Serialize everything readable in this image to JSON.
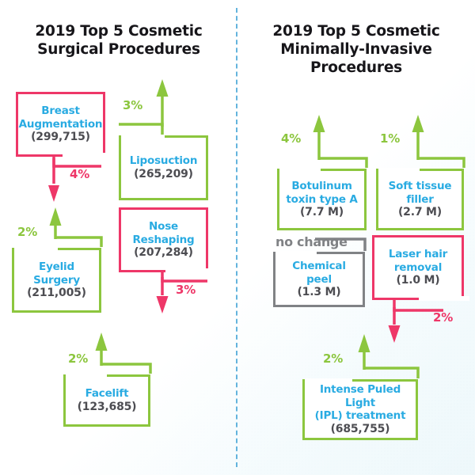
{
  "colors": {
    "green": "#8cc63e",
    "pink": "#ee3768",
    "gray": "#808285",
    "label_blue": "#29abe2",
    "value_gray": "#4d4d52",
    "title_black": "#17161a",
    "divider_blue": "#4aa8d8"
  },
  "panels": {
    "left": {
      "title_line1": "2019 Top 5 Cosmetic",
      "title_line2": "Surgical Procedures",
      "title_line3": "",
      "items": [
        {
          "name_line1": "Breast",
          "name_line2": "Augmentation",
          "value": "(299,715)",
          "change": "4%",
          "direction": "down",
          "color": "pink"
        },
        {
          "name_line1": "Liposuction",
          "name_line2": "",
          "value": "(265,209)",
          "change": "3%",
          "direction": "up",
          "color": "green"
        },
        {
          "name_line1": "Eyelid",
          "name_line2": "Surgery",
          "value": "(211,005)",
          "change": "2%",
          "direction": "up",
          "color": "green"
        },
        {
          "name_line1": "Nose",
          "name_line2": "Reshaping",
          "value": "(207,284)",
          "change": "3%",
          "direction": "down",
          "color": "pink"
        },
        {
          "name_line1": "Facelift",
          "name_line2": "",
          "value": "(123,685)",
          "change": "2%",
          "direction": "up",
          "color": "green"
        }
      ]
    },
    "right": {
      "title_line1": "2019 Top 5 Cosmetic",
      "title_line2": "Minimally-Invasive",
      "title_line3": "Procedures",
      "items": [
        {
          "name_line1": "Botulinum",
          "name_line2": "toxin type A",
          "value": "(7.7 M)",
          "change": "4%",
          "direction": "up",
          "color": "green"
        },
        {
          "name_line1": "Soft tissue",
          "name_line2": "filler",
          "value": "(2.7 M)",
          "change": "1%",
          "direction": "up",
          "color": "green"
        },
        {
          "name_line1": "Chemical",
          "name_line2": "peel",
          "value": "(1.3 M)",
          "change": "no change",
          "direction": "flat",
          "color": "gray"
        },
        {
          "name_line1": "Laser hair",
          "name_line2": "removal",
          "value": "(1.0 M)",
          "change": "2%",
          "direction": "down",
          "color": "pink"
        },
        {
          "name_line1": "Intense Puled Light",
          "name_line2": "(IPL) treatment",
          "value": "(685,755)",
          "change": "2%",
          "direction": "up",
          "color": "green"
        }
      ]
    }
  }
}
